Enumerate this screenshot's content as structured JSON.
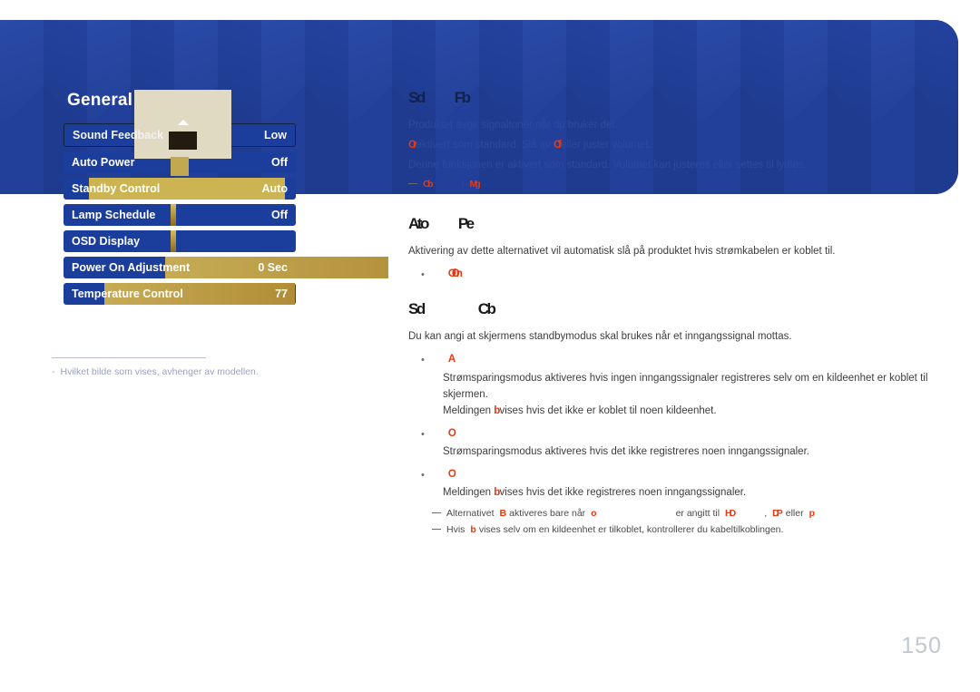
{
  "osd": {
    "title": "General",
    "rows": [
      {
        "label": "Sound Feedback",
        "value": "Low",
        "selected": true,
        "artifact": "none"
      },
      {
        "label": "Auto Power",
        "value": "Off",
        "selected": false,
        "artifact": "none"
      },
      {
        "label": "Standby Control",
        "value": "Auto",
        "selected": false,
        "artifact": "wide"
      },
      {
        "label": "Lamp Schedule",
        "value": "Off",
        "selected": false,
        "artifact": "narrow"
      },
      {
        "label": "OSD Display",
        "value": "",
        "selected": false,
        "artifact": "narrow"
      },
      {
        "label": "Power On Adjustment",
        "value": "0 Sec",
        "selected": false,
        "artifact": "mid"
      },
      {
        "label": "Temperature Control",
        "value": "77",
        "selected": false,
        "artifact": "mid2"
      }
    ]
  },
  "caption": {
    "dash": "-",
    "text": "Hvilket bilde som vises, avhenger av modellen."
  },
  "sections": [
    {
      "title_a": "Sd",
      "title_b": "Fb",
      "paragraphs": [
        "Produktet avgir signaltoner når du bruker det.",
        "Denne funksjonen er aktivert som standard. Volumet kan justeres eller settes til lydløs."
      ],
      "mixed_line": {
        "red_1": "Or",
        "text_1": " aktivert som standard. Slå av ",
        "red_2": "Of",
        "text_2": " eller juster volumet."
      },
      "note": {
        "red_1": "Ob",
        "gap": "",
        "sep": "/",
        "red_2": "Mg"
      }
    },
    {
      "title_a": "Ato",
      "title_b": "Pe",
      "paragraphs": [
        "Aktivering av dette alternativet vil automatisk slå på produktet hvis strømkabelen er koblet til."
      ],
      "bullets": [
        {
          "red": "Of On",
          "body": ""
        }
      ]
    },
    {
      "title_a": "Sd",
      "title_b": "Cb",
      "paragraphs": [
        "Du kan angi at skjermens standbymodus skal brukes når et inngangssignal mottas."
      ],
      "bullets": [
        {
          "red": "A",
          "body_1": "Strømsparingsmodus aktiveres hvis ingen inngangssignaler registreres selv om en kildeenhet er koblet til skjermen.",
          "body_2_pre": "Meldingen ",
          "body_2_red": "b",
          "body_2_post": " vises hvis det ikke er koblet til noen kildeenhet."
        },
        {
          "red": "O",
          "body_1": "Strømsparingsmodus aktiveres hvis det ikke registreres noen inngangssignaler.",
          "body_2_pre": "",
          "body_2_red": "",
          "body_2_post": ""
        },
        {
          "red": "O",
          "body_1": "",
          "body_2_pre": "Meldingen ",
          "body_2_red": "b",
          "body_2_post": " vises hvis det ikke registreres noen inngangssignaler."
        }
      ],
      "notes": [
        {
          "pre": "Alternativet ",
          "red_1": "B",
          "mid_1": " aktiveres bare når ",
          "red_2": "o",
          "mid_2": " er angitt til ",
          "red_3": "HD",
          "mid_3": ", ",
          "red_4": "DP",
          "mid_4": " eller ",
          "red_5": "p"
        },
        {
          "pre": "Hvis ",
          "red_1": "b",
          "mid_1": " vises selv om en kildeenhet er tilkoblet, kontrollerer du kabeltilkoblingen."
        }
      ]
    }
  ],
  "page_number": "150",
  "colors": {
    "banner": "#203f96",
    "menu_row": "#1b3d9c",
    "gold": "#c6ab55",
    "red_token": "#e8380d",
    "page_number": "#c3c7d2"
  }
}
